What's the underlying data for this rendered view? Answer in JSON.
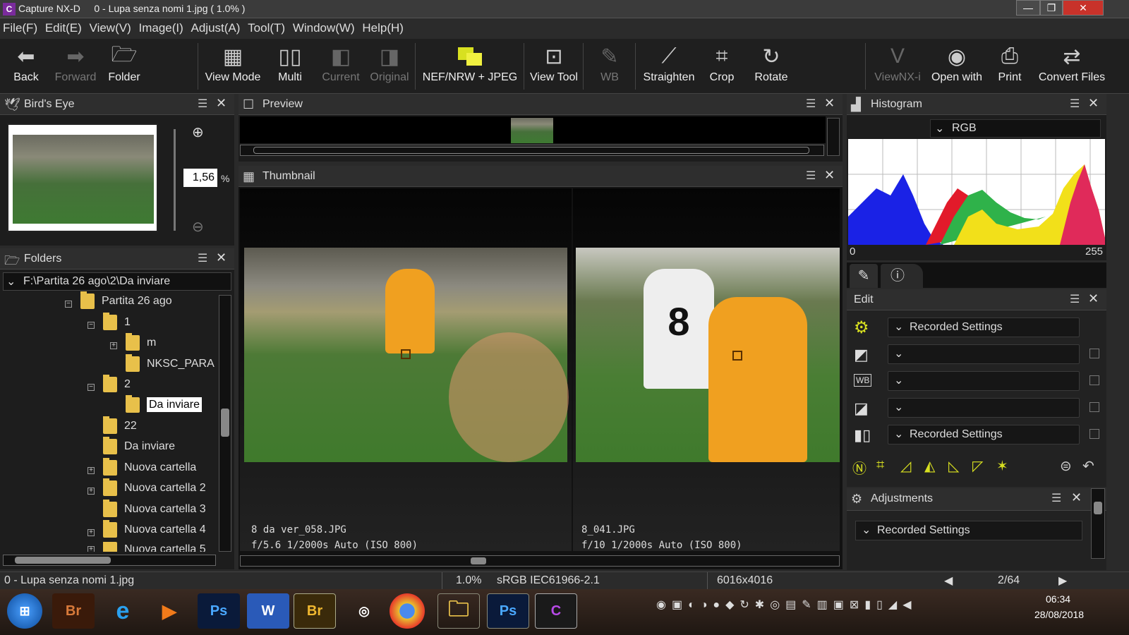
{
  "window": {
    "app_name": "Capture NX-D",
    "doc_title": "0 - Lupa senza nomi 1.jpg ( 1.0% )"
  },
  "menu": [
    "File(F)",
    "Edit(E)",
    "View(V)",
    "Image(I)",
    "Adjust(A)",
    "Tool(T)",
    "Window(W)",
    "Help(H)"
  ],
  "toolbar": {
    "back": "Back",
    "forward": "Forward",
    "folder": "Folder",
    "view_mode": "View Mode",
    "multi": "Multi",
    "current": "Current",
    "original": "Original",
    "nef_jpeg": "NEF/NRW + JPEG",
    "view_tool": "View Tool",
    "wb": "WB",
    "straighten": "Straighten",
    "crop": "Crop",
    "rotate": "Rotate",
    "viewnx": "ViewNX-i",
    "open_with": "Open with",
    "print": "Print",
    "convert": "Convert Files"
  },
  "birds_eye": {
    "title": "Bird's Eye",
    "zoom_value": "1,56",
    "zoom_unit": "%"
  },
  "folders": {
    "title": "Folders",
    "path": "F:\\Partita 26 ago\\2\\Da inviare",
    "items": [
      "Partita 26 ago",
      "1",
      "m",
      "NKSC_PARA",
      "2",
      "Da inviare",
      "22",
      "Da inviare",
      "Nuova cartella",
      "Nuova cartella 2",
      "Nuova cartella 3",
      "Nuova cartella 4",
      "Nuova cartella 5"
    ]
  },
  "preview": {
    "title": "Preview"
  },
  "thumbnail": {
    "title": "Thumbnail",
    "items": [
      {
        "name": "8 da ver_058.JPG",
        "exif": "f/5.6 1/2000s Auto (ISO 800)"
      },
      {
        "name": "8_041.JPG",
        "exif": "f/10 1/2000s Auto (ISO 800)"
      }
    ]
  },
  "histogram": {
    "title": "Histogram",
    "channel": "RGB",
    "min": "0",
    "max": "255"
  },
  "edit": {
    "title": "Edit",
    "rows": [
      "Recorded Settings",
      "",
      "",
      "",
      "Recorded Settings"
    ]
  },
  "adjustments": {
    "title": "Adjustments",
    "value": "Recorded Settings"
  },
  "status": {
    "file": "0 - Lupa senza nomi 1.jpg",
    "zoom": "1.0%",
    "profile": "sRGB IEC61966-2.1",
    "dimensions": "6016x4016",
    "page": "2/64"
  },
  "taskbar": {
    "time": "06:34",
    "date": "28/08/2018"
  },
  "colors": {
    "accent_purple": "#7a2b9c",
    "folder_yellow": "#e8c04a",
    "jersey_orange": "#f0a020"
  }
}
